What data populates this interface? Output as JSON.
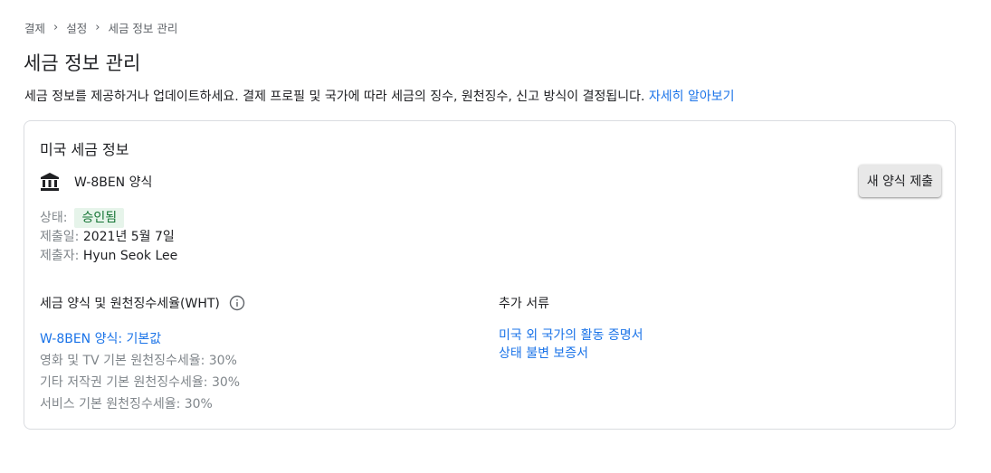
{
  "breadcrumb": {
    "items": [
      "결제",
      "설정",
      "세금 정보 관리"
    ],
    "separator": "›"
  },
  "page": {
    "title": "세금 정보 관리",
    "intro_text": "세금 정보를 제공하거나 업데이트하세요. 결제 프로필 및 국가에 따라 세금의 징수, 원천징수, 신고 방식이 결정됩니다. ",
    "learn_more_label": "자세히 알아보기"
  },
  "card": {
    "title": "미국 세금 정보",
    "form_icon": "bank-icon",
    "form_name": "W-8BEN 양식",
    "submit_button_label": "새 양식 제출",
    "status_label": "상태:",
    "status_value": "승인됨",
    "submitted_date_label": "제출일:",
    "submitted_date_value": "2021년 5월 7일",
    "submitter_label": "제출자:",
    "submitter_value": "Hyun Seok Lee",
    "wht": {
      "header": "세금 양식 및 원천징수세율(WHT)",
      "info_icon": "info-icon",
      "form_link": "W-8BEN 양식: 기본값",
      "rates": [
        "영화 및 TV 기본 원천징수세율: 30%",
        "기타 저작권 기본 원천징수세율: 30%",
        "서비스 기본 원천징수세율: 30%"
      ]
    },
    "docs": {
      "header": "추가 서류",
      "links": [
        "미국 외 국가의 활동 증명서",
        "상태 불변 보증서"
      ]
    }
  },
  "colors": {
    "link": "#1a73e8",
    "status_bg": "#e6f4ea",
    "status_text": "#137333",
    "muted": "#80868b",
    "border": "#dadce0"
  }
}
